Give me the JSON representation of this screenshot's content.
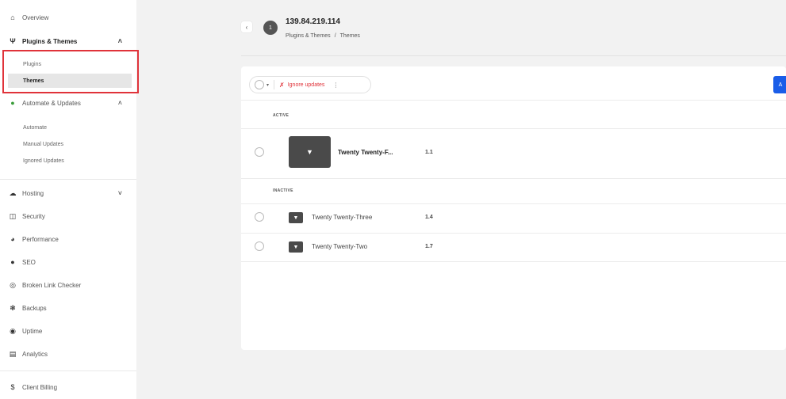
{
  "sidebar": {
    "overview": {
      "label": "Overview",
      "icon": "home-icon"
    },
    "plugins_themes": {
      "label": "Plugins & Themes",
      "icon": "plug-icon",
      "sub": {
        "plugins": "Plugins",
        "themes": "Themes"
      }
    },
    "automate_updates": {
      "label": "Automate & Updates",
      "icon": "update-icon",
      "sub": {
        "automate": "Automate",
        "manual": "Manual Updates",
        "ignored": "Ignored Updates"
      }
    },
    "hosting": {
      "label": "Hosting",
      "icon": "cloud-icon"
    },
    "security": {
      "label": "Security",
      "icon": "shield-icon"
    },
    "performance": {
      "label": "Performance",
      "icon": "gauge-icon"
    },
    "seo": {
      "label": "SEO",
      "icon": "seo-icon"
    },
    "broken_link": {
      "label": "Broken Link Checker",
      "icon": "globe-icon"
    },
    "backups": {
      "label": "Backups",
      "icon": "backup-icon"
    },
    "uptime": {
      "label": "Uptime",
      "icon": "uptime-icon"
    },
    "analytics": {
      "label": "Analytics",
      "icon": "chart-icon"
    },
    "client_billing": {
      "label": "Client Billing",
      "icon": "dollar-icon"
    }
  },
  "header": {
    "back": "‹",
    "avatar": "1",
    "title": "139.84.219.114",
    "crumb_parent": "Plugins & Themes",
    "crumb_sep": "/",
    "crumb_current": "Themes"
  },
  "toolbar": {
    "ignore_label": "Ignore updates",
    "primary_label": "A"
  },
  "themes": {
    "active_label": "ACTIVE",
    "inactive_label": "INACTIVE",
    "active": [
      {
        "name": "Twenty Twenty-F...",
        "version": "1.1"
      }
    ],
    "inactive": [
      {
        "name": "Twenty Twenty-Three",
        "version": "1.4"
      },
      {
        "name": "Twenty Twenty-Two",
        "version": "1.7"
      }
    ]
  },
  "colors": {
    "accent": "#1a5de8",
    "danger": "#e0333a",
    "highlight": "#e0333a"
  }
}
